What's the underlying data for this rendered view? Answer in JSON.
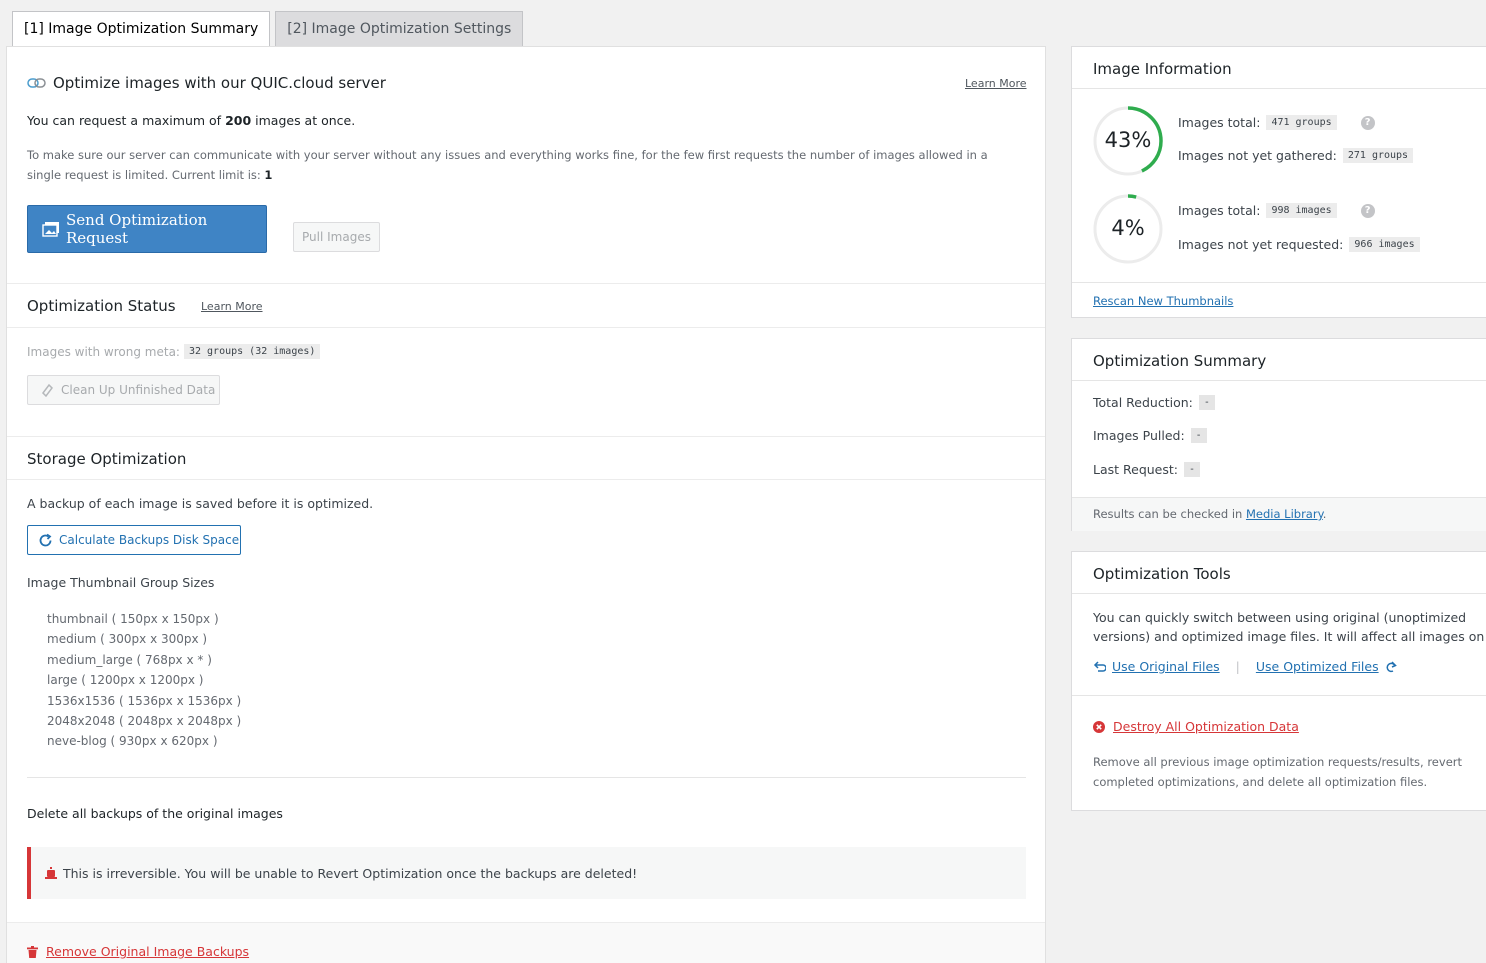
{
  "tabs": [
    {
      "label": "[1] Image Optimization Summary",
      "active": true
    },
    {
      "label": "[2] Image Optimization Settings",
      "active": false
    }
  ],
  "request": {
    "title": "Optimize images with our QUIC.cloud server",
    "learn_more": "Learn More",
    "max_text_pre": "You can request a maximum of",
    "max_value": "200",
    "max_text_post": "images at once.",
    "limit_note": "To make sure our server can communicate with your server without any issues and everything works fine, for the few first requests the number of images allowed in a single request is limited. Current limit is:",
    "limit_value": "1",
    "send_button": "Send Optimization Request",
    "pull_button": "Pull Images"
  },
  "status": {
    "title": "Optimization Status",
    "learn_more": "Learn More",
    "wrong_meta_label": "Images with wrong meta:",
    "wrong_meta_value": "32 groups (32 images)",
    "cleanup_button": "Clean Up Unfinished Data"
  },
  "storage": {
    "title": "Storage Optimization",
    "backup_note": "A backup of each image is saved before it is optimized.",
    "calc_button": "Calculate Backups Disk Space",
    "sizes_title": "Image Thumbnail Group Sizes",
    "sizes": [
      "thumbnail ( 150px x 150px )",
      "medium ( 300px x 300px )",
      "medium_large ( 768px x * )",
      "large ( 1200px x 1200px )",
      "1536x1536 ( 1536px x 1536px )",
      "2048x2048 ( 2048px x 2048px )",
      "neve-blog ( 930px x 620px )"
    ],
    "delete_title": "Delete all backups of the original images",
    "alert_text": "This is irreversible. You will be unable to Revert Optimization once the backups are deleted!",
    "remove_link": "Remove Original Image Backups"
  },
  "image_info": {
    "title": "Image Information",
    "groups_percent_label": "43%",
    "groups_percent": 43,
    "groups_total_label": "Images total:",
    "groups_total": "471 groups",
    "not_gathered_label": "Images not yet gathered:",
    "not_gathered": "271 groups",
    "images_percent_label": "4%",
    "images_percent": 4,
    "images_total_label": "Images total:",
    "images_total": "998 images",
    "not_requested_label": "Images not yet requested:",
    "not_requested": "966 images",
    "help_icon": "?",
    "rescan_link": "Rescan New Thumbnails",
    "ring_color": "#2fac4e"
  },
  "summary": {
    "title": "Optimization Summary",
    "total_reduction_label": "Total Reduction:",
    "total_reduction": "-",
    "pulled_label": "Images Pulled:",
    "pulled": "-",
    "last_request_label": "Last Request:",
    "last_request": "-",
    "results_pre": "Results can be checked in",
    "media_library": "Media Library",
    "results_post": "."
  },
  "tools": {
    "title": "Optimization Tools",
    "desc": "You can quickly switch between using original (unoptimized versions) and optimized image files. It will affect all images on your website, both regular and webp versions.",
    "use_original": "Use Original Files",
    "separator": "|",
    "use_optimized": "Use Optimized Files",
    "destroy_link": "Destroy All Optimization Data",
    "destroy_desc": "Remove all previous image optimization requests/results, revert completed optimizations, and delete all optimization files."
  }
}
